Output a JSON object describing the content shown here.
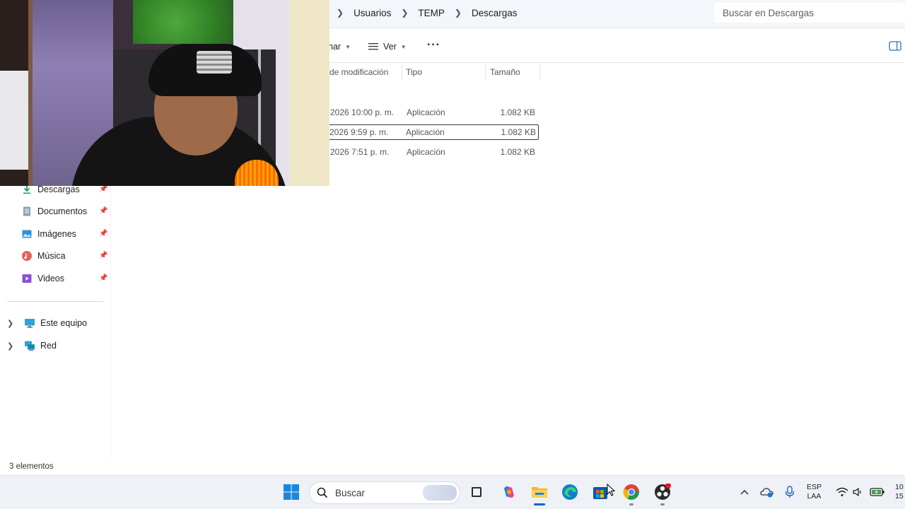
{
  "breadcrumb": {
    "items": [
      "Usuarios",
      "TEMP",
      "Descargas"
    ]
  },
  "search": {
    "placeholder": "Buscar en Descargas"
  },
  "toolbar": {
    "sort_label": "nar",
    "view_label": "Ver",
    "more_label": "···"
  },
  "columns": {
    "modified": "de modificación",
    "type": "Tipo",
    "size": "Tamaño"
  },
  "files": [
    {
      "modified": "2026 10:00 p. m.",
      "type": "Aplicación",
      "size": "1.082 KB",
      "selected": false
    },
    {
      "modified": "2026 9:59 p. m.",
      "type": "Aplicación",
      "size": "1.082 KB",
      "selected": true
    },
    {
      "modified": "2026 7:51 p. m.",
      "type": "Aplicación",
      "size": "1.082 KB",
      "selected": false
    }
  ],
  "sidebar": {
    "quick_access": [
      {
        "label": "Descargas",
        "icon": "download-icon"
      },
      {
        "label": "Documentos",
        "icon": "document-icon"
      },
      {
        "label": "Imágenes",
        "icon": "image-icon"
      },
      {
        "label": "Música",
        "icon": "music-icon"
      },
      {
        "label": "Videos",
        "icon": "video-icon"
      }
    ],
    "locations": [
      {
        "label": "Este equipo",
        "icon": "computer-icon"
      },
      {
        "label": "Red",
        "icon": "network-icon"
      }
    ]
  },
  "status": {
    "count": "3 elementos"
  },
  "taskbar": {
    "search_label": "Buscar",
    "apps": [
      "start-icon",
      "task-view-icon",
      "copilot-icon",
      "file-explorer-icon",
      "edge-icon",
      "store-icon",
      "chrome-icon",
      "obs-icon"
    ]
  },
  "tray": {
    "lang_top": "ESP",
    "lang_bottom": "LAA",
    "clock_top": "10",
    "clock_bottom": "15"
  },
  "colors": {
    "accent": "#0067c0",
    "address_bg": "#f3f6fb",
    "taskbar_bg": "#eef1f6"
  }
}
